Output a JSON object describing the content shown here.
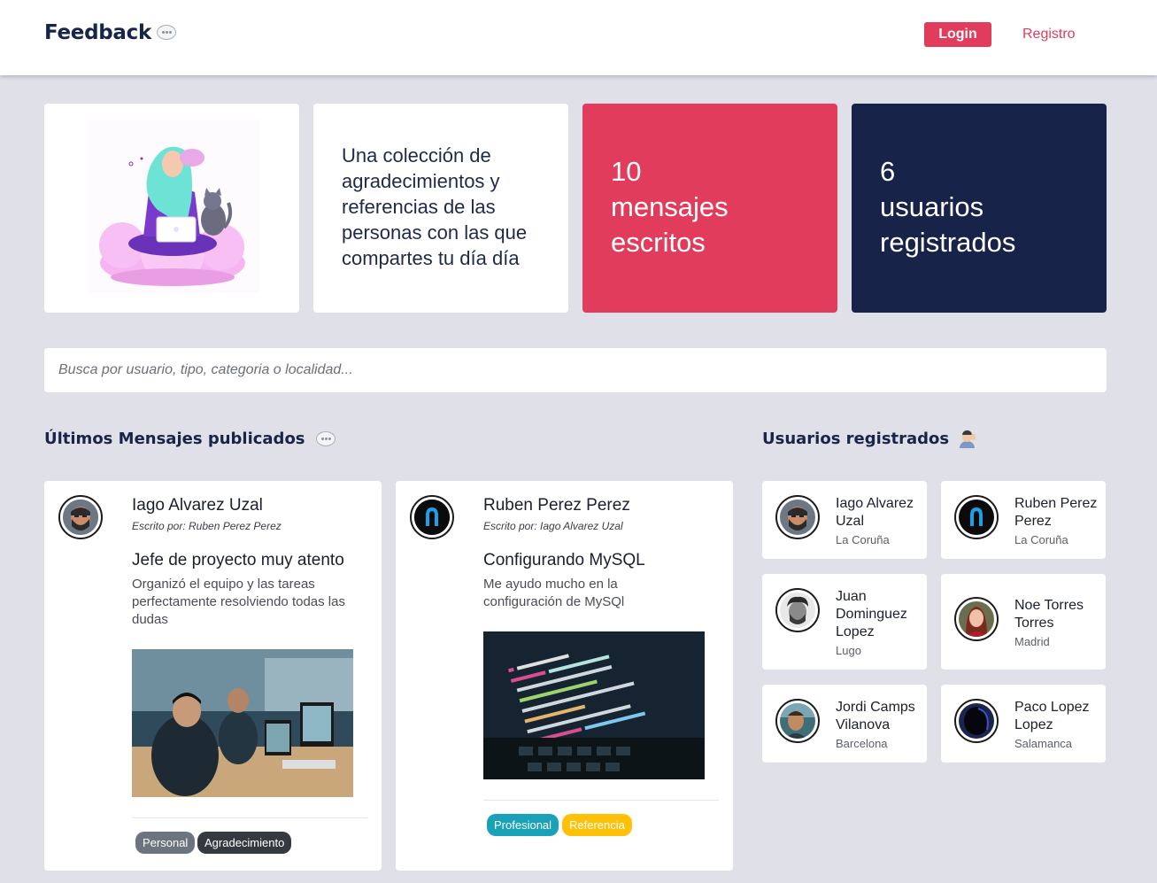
{
  "navbar": {
    "brand": "Feedback",
    "brand_icon": "speech-bubble-icon",
    "login_label": "Login",
    "registro_label": "Registro"
  },
  "hero": {
    "illustration": "woman-with-laptop-on-cloud-illustration",
    "tagline": "Una colección de agradecimientos y referencias de las personas con las que compartes tu día día",
    "messages_count": "10",
    "messages_label": "mensajes escritos",
    "users_count": "6",
    "users_label": "usuarios registrados"
  },
  "search": {
    "placeholder": "Busca por usuario, tipo, categoria o localidad..."
  },
  "messages_section": {
    "title": "Últimos Mensajes publicados",
    "icon": "speech-bubble-icon",
    "messages": [
      {
        "author": "Iago Alvarez Uzal",
        "written_by": "Escrito por: Ruben Perez Perez",
        "title": "Jefe de proyecto muy atento",
        "body": "Organizó el equipo y las tareas perfectamente resolviendo todas las dudas",
        "image": "team-working-at-computers-photo",
        "tags": [
          "Personal",
          "Agradecimiento"
        ]
      },
      {
        "author": "Ruben Perez Perez",
        "written_by": "Escrito por: Iago Alvarez Uzal",
        "title": "Configurando MySQL",
        "body": "Me ayudo mucho en la configuración de MySQl",
        "image": "code-on-laptop-screen-photo",
        "tags": [
          "Profesional",
          "Referencia"
        ]
      }
    ]
  },
  "users_section": {
    "title": "Usuarios registrados",
    "icon": "person-raising-hand-icon",
    "users": [
      {
        "name": "Iago Alvarez Uzal",
        "city": "La Coruña"
      },
      {
        "name": "Ruben Perez Perez",
        "city": "La Coruña"
      },
      {
        "name": "Juan Dominguez Lopez",
        "city": "Lugo"
      },
      {
        "name": "Noe Torres Torres",
        "city": "Madrid"
      },
      {
        "name": "Jordi Camps Vilanova",
        "city": "Barcelona"
      },
      {
        "name": "Paco Lopez Lopez",
        "city": "Salamanca"
      }
    ]
  },
  "colors": {
    "accent": "#e23c5c",
    "navy": "#172348",
    "background": "#dfe0e8",
    "tag_personal": "#6c757d",
    "tag_agradecimiento": "#343a40",
    "tag_profesional": "#17a2b8",
    "tag_referencia": "#ffc107"
  }
}
